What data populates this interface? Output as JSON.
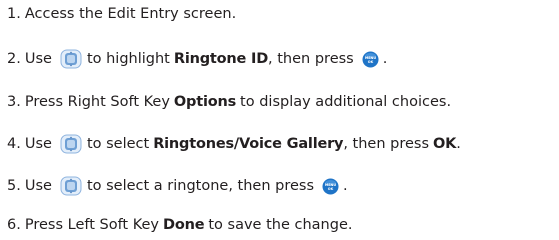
{
  "steps": [
    {
      "number": "1.",
      "text": "Access the Edit Entry screen."
    },
    {
      "number": "2.",
      "pre": "Use",
      "icon1": "navigation-key-icon",
      "mid": "to highlight",
      "bold": "Ringtone ID",
      "post": ", then press",
      "icon2": "menu-ok-key-icon",
      "end": "."
    },
    {
      "number": "3.",
      "pre": "Press Right Soft Key",
      "bold": "Options",
      "post": "to display additional choices."
    },
    {
      "number": "4.",
      "pre": "Use",
      "icon1": "navigation-key-icon",
      "mid": "to select",
      "bold": "Ringtones/Voice Gallery",
      "post": ", then press",
      "bold2": "OK",
      "end": "."
    },
    {
      "number": "5.",
      "pre": "Use",
      "icon1": "navigation-key-icon",
      "mid": "to select a ringtone, then press",
      "icon2": "menu-ok-key-icon",
      "end": "."
    },
    {
      "number": "6.",
      "pre": "Press Left Soft Key",
      "bold": "Done",
      "post": "to save the change."
    }
  ],
  "menu_key_label_top": "MENU",
  "menu_key_label_bottom": "OK",
  "colors": {
    "text": "#231f20",
    "nav_key": "#6e9fd4",
    "menu_key": "#1f74c7"
  }
}
